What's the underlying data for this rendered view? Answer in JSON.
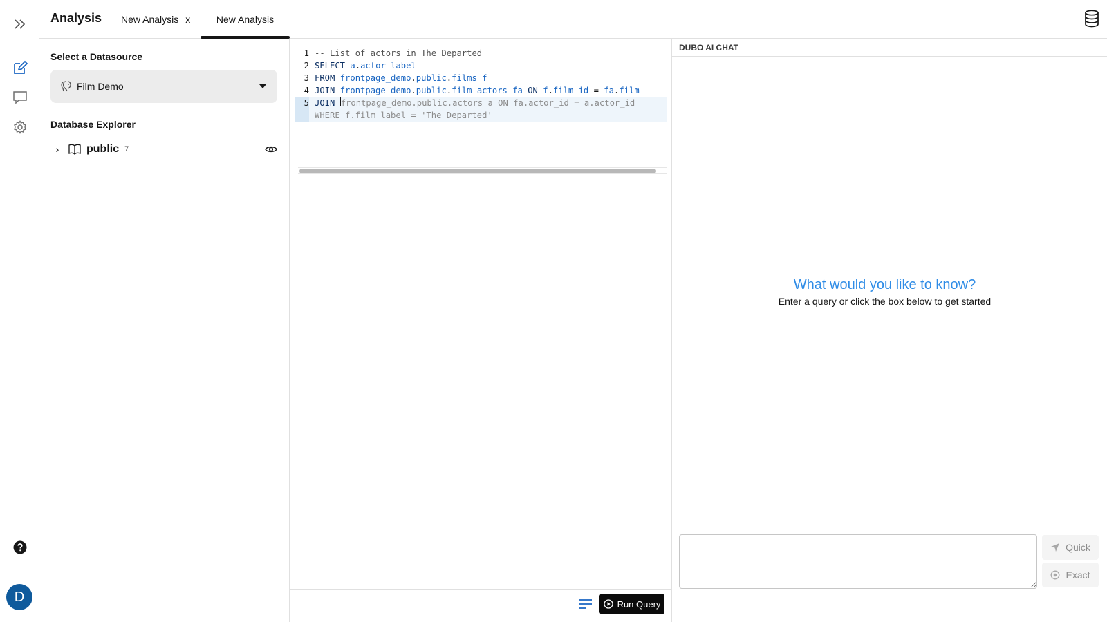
{
  "header": {
    "title": "Analysis",
    "tabs": [
      {
        "label": "New Analysis",
        "close": "x"
      },
      {
        "label": "New Analysis"
      }
    ]
  },
  "rail": {
    "icons": [
      "expand-icon",
      "edit-icon",
      "chat-icon",
      "gear-icon",
      "help-icon"
    ],
    "avatar_initial": "D"
  },
  "datasource": {
    "heading": "Select a Datasource",
    "selected": "Film Demo"
  },
  "explorer": {
    "heading": "Database Explorer",
    "schema": {
      "name": "public",
      "count": "7"
    }
  },
  "editor": {
    "lines": [
      {
        "n": "1",
        "tokens": [
          {
            "t": "-- List of actors in The Departed",
            "c": "comment"
          }
        ]
      },
      {
        "n": "2",
        "tokens": [
          {
            "t": "SELECT ",
            "c": "kw"
          },
          {
            "t": "a",
            "c": "id"
          },
          {
            "t": ".",
            "c": "plain"
          },
          {
            "t": "actor_label",
            "c": "id"
          }
        ]
      },
      {
        "n": "3",
        "tokens": [
          {
            "t": "FROM ",
            "c": "kw"
          },
          {
            "t": "frontpage_demo",
            "c": "id"
          },
          {
            "t": ".",
            "c": "plain"
          },
          {
            "t": "public",
            "c": "id"
          },
          {
            "t": ".",
            "c": "plain"
          },
          {
            "t": "films f",
            "c": "id"
          }
        ]
      },
      {
        "n": "4",
        "tokens": [
          {
            "t": "JOIN ",
            "c": "kw"
          },
          {
            "t": "frontpage_demo",
            "c": "id"
          },
          {
            "t": ".",
            "c": "plain"
          },
          {
            "t": "public",
            "c": "id"
          },
          {
            "t": ".",
            "c": "plain"
          },
          {
            "t": "film_actors fa ",
            "c": "id"
          },
          {
            "t": "ON ",
            "c": "kw"
          },
          {
            "t": "f",
            "c": "id"
          },
          {
            "t": ".",
            "c": "plain"
          },
          {
            "t": "film_id ",
            "c": "id"
          },
          {
            "t": "= ",
            "c": "plain"
          },
          {
            "t": "fa",
            "c": "id"
          },
          {
            "t": ".",
            "c": "plain"
          },
          {
            "t": "film_",
            "c": "id"
          }
        ]
      },
      {
        "n": "5",
        "active": true,
        "tokens": [
          {
            "t": "JOIN ",
            "c": "kw"
          },
          {
            "t": "|",
            "c": "cursor"
          },
          {
            "t": "frontpage_demo.public.actors a ON fa.actor_id = a.actor_id",
            "c": "ghost"
          }
        ]
      },
      {
        "n": "",
        "ghost": true,
        "tokens": [
          {
            "t": "WHERE f.film_label = 'The Departed'",
            "c": "ghost"
          }
        ]
      }
    ],
    "run_label": "Run Query"
  },
  "chat": {
    "title": "DUBO AI CHAT",
    "prompt": "What would you like to know?",
    "subtitle": "Enter a query or click the box below to get started",
    "input_placeholder": "",
    "quick_label": "Quick",
    "exact_label": "Exact"
  },
  "colors": {
    "accent": "#2f8ce6",
    "avatar": "#0f5a9c",
    "run_button": "#0b0b0b"
  }
}
